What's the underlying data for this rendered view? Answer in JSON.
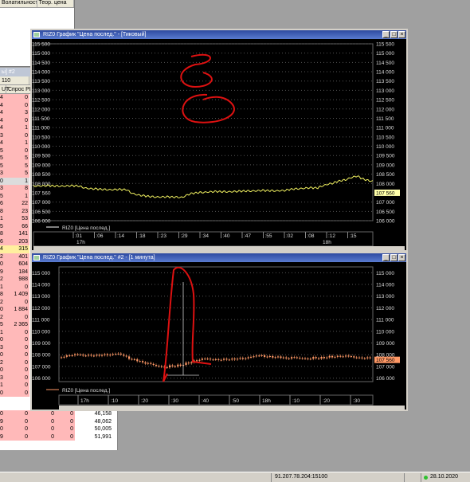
{
  "top_table": {
    "headers": [
      "Волатильность",
      "Теор. цена"
    ]
  },
  "order_book": {
    "title": "ы] #2",
    "header_row1": [
      "110",
      "Сп"
    ],
    "header_row2": [
      "UT",
      "Спрос РІ"
    ],
    "rows": [
      {
        "a": "4",
        "b": "0"
      },
      {
        "a": "4",
        "b": "0"
      },
      {
        "a": "4",
        "b": "3"
      },
      {
        "a": "4",
        "b": "0"
      },
      {
        "a": "4",
        "b": "1"
      },
      {
        "a": "3",
        "b": "0"
      },
      {
        "a": "4",
        "b": "1"
      },
      {
        "a": "5",
        "b": "0"
      },
      {
        "a": "5",
        "b": "5"
      },
      {
        "a": "5",
        "b": "5"
      },
      {
        "a": "3",
        "b": "5"
      },
      {
        "a": "0",
        "b": "1",
        "gray": true
      },
      {
        "a": "3",
        "b": "8"
      },
      {
        "a": "5",
        "b": "1"
      },
      {
        "a": "6",
        "b": "22"
      },
      {
        "a": "8",
        "b": "23"
      },
      {
        "a": "1",
        "b": "53"
      },
      {
        "a": "5",
        "b": "66"
      },
      {
        "a": "8",
        "b": "141"
      },
      {
        "a": "6",
        "b": "203"
      },
      {
        "a": "4",
        "b": "315",
        "hl": true
      },
      {
        "a": "2",
        "b": "401"
      },
      {
        "a": "0",
        "b": "604"
      },
      {
        "a": "9",
        "b": "184"
      },
      {
        "a": "2",
        "b": "988"
      },
      {
        "a": "1",
        "b": "0"
      },
      {
        "a": "8",
        "b": "1 409"
      },
      {
        "a": "2",
        "b": "0"
      },
      {
        "a": "0",
        "b": "1 884"
      },
      {
        "a": "2",
        "b": "0"
      },
      {
        "a": "5",
        "b": "2 365"
      },
      {
        "a": "1",
        "b": "0"
      },
      {
        "a": "0",
        "b": "0"
      },
      {
        "a": "3",
        "b": "0"
      },
      {
        "a": "0",
        "b": "0"
      },
      {
        "a": "2",
        "b": "0"
      },
      {
        "a": "0",
        "b": "0"
      },
      {
        "a": "3",
        "b": "0"
      },
      {
        "a": "1",
        "b": "0"
      },
      {
        "a": "0",
        "b": "0"
      }
    ],
    "bottom_rows": [
      {
        "a": "0",
        "b": "0",
        "c": "0",
        "d": "0",
        "e": "46,158"
      },
      {
        "a": "9",
        "b": "0",
        "c": "0",
        "d": "0",
        "e": "48,062"
      },
      {
        "a": "0",
        "b": "0",
        "c": "0",
        "d": "0",
        "e": "50,005"
      },
      {
        "a": "9",
        "b": "0",
        "c": "0",
        "d": "0",
        "e": "51,991"
      }
    ]
  },
  "chart1": {
    "title": "RIZ0 График \"Цена послед.\" - [Тиковый]",
    "legend": "RIZ0 [Цена послед.]",
    "price_label": "107 560",
    "y_ticks": [
      "115 500",
      "115 000",
      "114 500",
      "114 000",
      "113 500",
      "113 000",
      "112 500",
      "112 000",
      "111 500",
      "111 000",
      "110 500",
      "110 000",
      "109 500",
      "109 000",
      "108 500",
      "108 000",
      "107 560",
      "107 000",
      "106 500",
      "106 000"
    ],
    "x_ticks": [
      ":01",
      ":06",
      ":14",
      ":18",
      ":23",
      ":29",
      ":34",
      ":40",
      ":47",
      ":55",
      ":02",
      ":08",
      ":12",
      ":15"
    ],
    "hour_labels": [
      "17h",
      "18h"
    ],
    "line_color": "#f0f060"
  },
  "chart2": {
    "title": "RIZ0 График \"Цена послед.\" #2 - [1 минута]",
    "legend": "RIZ0 [Цена послед.]",
    "price_label": "107 560",
    "y_ticks": [
      "115 000",
      "114 000",
      "113 000",
      "112 000",
      "111 000",
      "110 000",
      "109 000",
      "108 000",
      "107 560",
      "107 000",
      "106 000"
    ],
    "x_ticks": [
      "17h",
      ":10",
      ":20",
      ":30",
      ":40",
      ":50",
      "18h",
      ":10",
      ":20",
      ":30"
    ],
    "candle_color": "#ff9966"
  },
  "status_bar": {
    "connection": "91.207.78.204:15100",
    "date": "28.10.2020"
  },
  "annotation_color": "#dd1111"
}
